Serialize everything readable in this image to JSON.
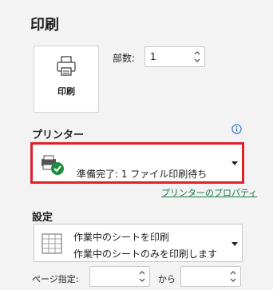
{
  "page": {
    "title": "印刷"
  },
  "print_button": {
    "label": "印刷",
    "icon": "printer-icon"
  },
  "copies": {
    "label": "部数:",
    "value": "1"
  },
  "printer": {
    "section_title": "プリンター",
    "status": "準備完了: 1 ファイル印刷待ち",
    "icon": "printer-ready-icon",
    "properties_link": "プリンターのプロパティ",
    "highlight_color": "#e0202a"
  },
  "settings": {
    "section_title": "設定",
    "scope_line1": "作業中のシートを印刷",
    "scope_line2": "作業中のシートのみを印刷します",
    "pages_label": "ページ指定:",
    "pages_from": "",
    "pages_to_label": "から",
    "pages_to": ""
  }
}
